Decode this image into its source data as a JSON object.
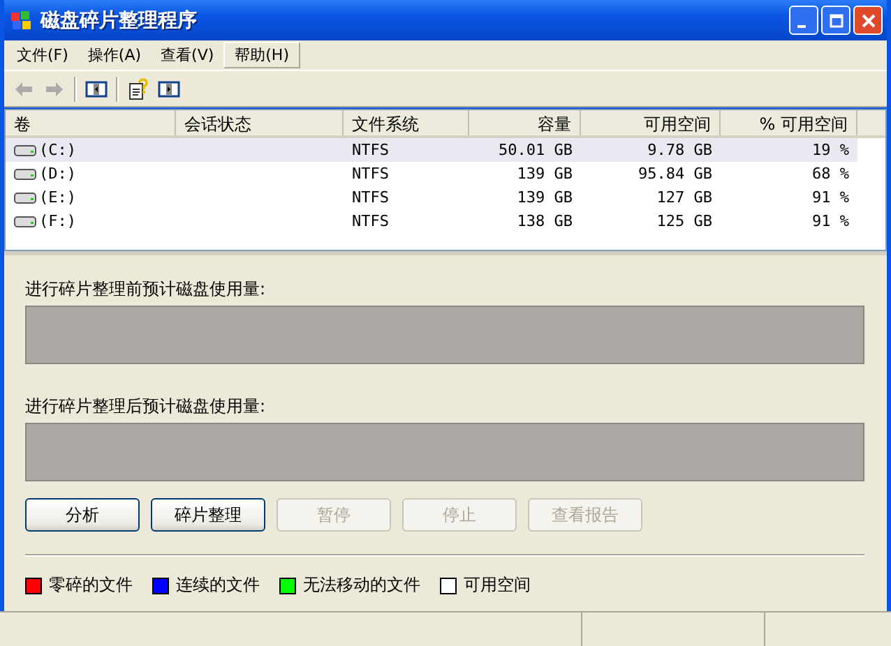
{
  "window": {
    "title": "磁盘碎片整理程序"
  },
  "menu": [
    {
      "label": "文件(F)",
      "selected": false
    },
    {
      "label": "操作(A)",
      "selected": false
    },
    {
      "label": "查看(V)",
      "selected": false
    },
    {
      "label": "帮助(H)",
      "selected": true
    }
  ],
  "toolbar": [
    {
      "kind": "back",
      "disabled": true
    },
    {
      "kind": "forward",
      "disabled": true
    },
    {
      "kind": "panel-left",
      "disabled": false
    },
    {
      "kind": "help",
      "disabled": false
    },
    {
      "kind": "panel-right",
      "disabled": false
    }
  ],
  "table": {
    "columns": [
      "卷",
      "会话状态",
      "文件系统",
      "容量",
      "可用空间",
      "% 可用空间"
    ],
    "rows": [
      {
        "selected": true,
        "cells": [
          "(C:)",
          "",
          "NTFS",
          "50.01 GB",
          "9.78 GB",
          "19 %"
        ]
      },
      {
        "selected": false,
        "cells": [
          "(D:)",
          "",
          "NTFS",
          "139 GB",
          "95.84 GB",
          "68 %"
        ]
      },
      {
        "selected": false,
        "cells": [
          "(E:)",
          "",
          "NTFS",
          "139 GB",
          "127 GB",
          "91 %"
        ]
      },
      {
        "selected": false,
        "cells": [
          "(F:)",
          "",
          "NTFS",
          "138 GB",
          "125 GB",
          "91 %"
        ]
      }
    ]
  },
  "before_label": "进行碎片整理前预计磁盘使用量:",
  "after_label": "进行碎片整理后预计磁盘使用量:",
  "buttons": [
    {
      "label": "分析",
      "disabled": false
    },
    {
      "label": "碎片整理",
      "disabled": false
    },
    {
      "label": "暂停",
      "disabled": true
    },
    {
      "label": "停止",
      "disabled": true
    },
    {
      "label": "查看报告",
      "disabled": true
    }
  ],
  "legend": [
    {
      "label": "零碎的文件",
      "color": "#ff0000"
    },
    {
      "label": "连续的文件",
      "color": "#0000ff"
    },
    {
      "label": "无法移动的文件",
      "color": "#00ff00"
    },
    {
      "label": "可用空间",
      "color": "#ffffff"
    }
  ]
}
